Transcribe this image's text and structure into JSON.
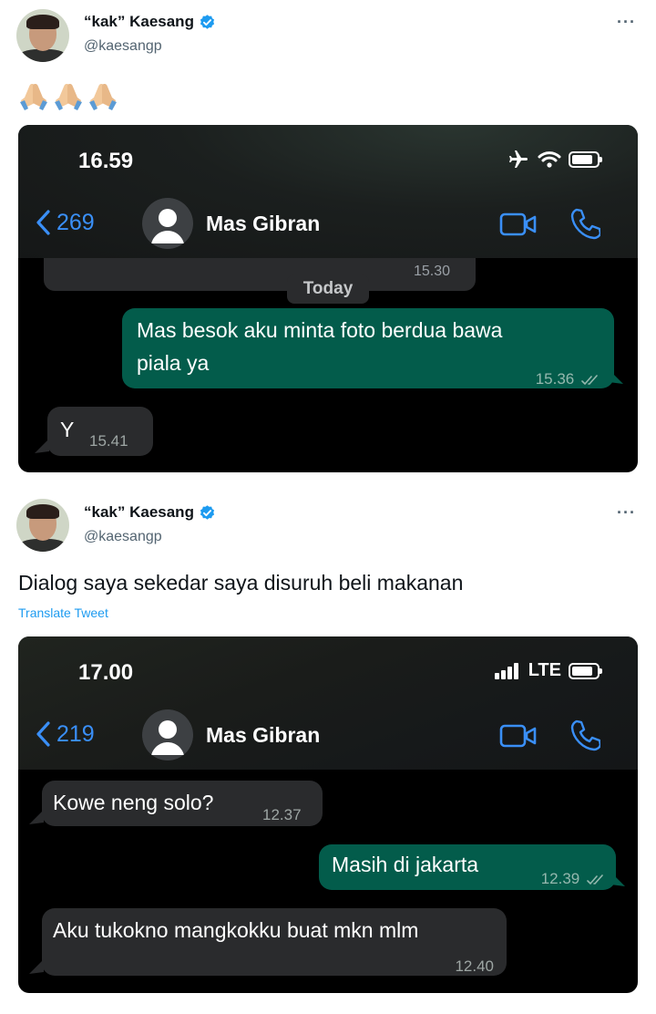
{
  "tweet1": {
    "display_name": "“kak” Kaesang",
    "handle": "@kaesangp",
    "more_label": "···",
    "text": "🙏🏼🙏🏼🙏🏼",
    "screenshot": {
      "clock": "16.59",
      "back_count": "269",
      "contact_name": "Mas Gibran",
      "top_time": "15.30",
      "date_pill": "Today",
      "messages": [
        {
          "direction": "out",
          "text_line1": "Mas besok aku minta foto berdua bawa",
          "text_line2": "piala ya",
          "time": "15.36",
          "read": true
        },
        {
          "direction": "in",
          "text": "Y",
          "time": "15.41"
        }
      ]
    }
  },
  "tweet2": {
    "display_name": "“kak” Kaesang",
    "handle": "@kaesangp",
    "more_label": "···",
    "text": "Dialog saya sekedar saya disuruh beli makanan",
    "translate_label": "Translate Tweet",
    "screenshot": {
      "clock": "17.00",
      "network": "LTE",
      "back_count": "219",
      "contact_name": "Mas Gibran",
      "messages": [
        {
          "direction": "in",
          "text": "Kowe neng solo?",
          "time": "12.37"
        },
        {
          "direction": "out",
          "text": "Masih di jakarta",
          "time": "12.39",
          "read": true
        },
        {
          "direction": "in",
          "text": "Aku tukokno mangkokku buat mkn mlm",
          "time": "12.40"
        }
      ]
    }
  },
  "colors": {
    "accent_blue": "#1d9bf0",
    "ios_blue": "#3a8ff7",
    "outgoing_bubble": "#035c4b",
    "incoming_bubble": "#2a2b2d"
  }
}
